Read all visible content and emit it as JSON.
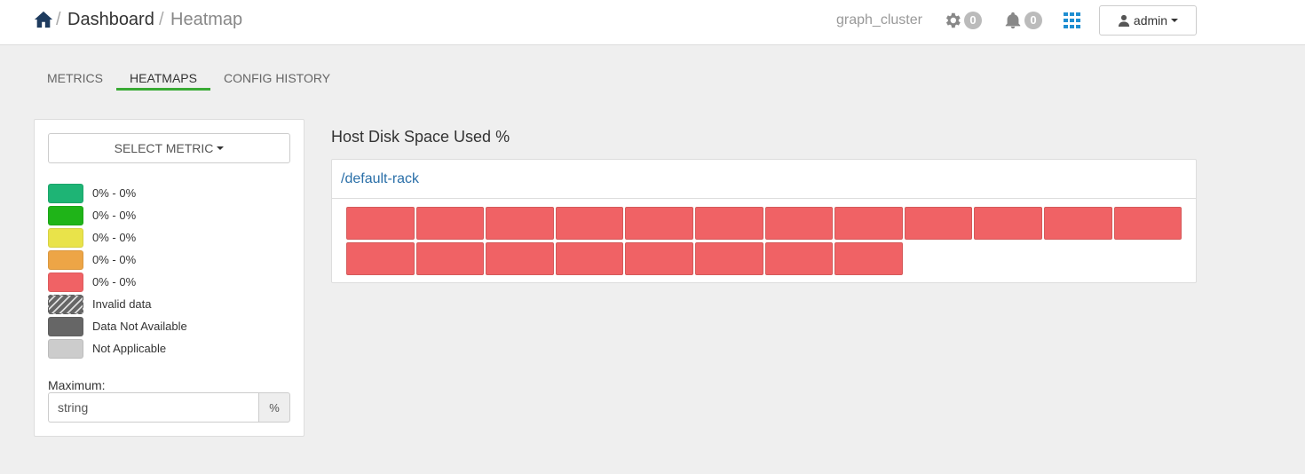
{
  "breadcrumb": {
    "sep1": "/",
    "dashboard": "Dashboard",
    "sep2": "/",
    "current": "Heatmap"
  },
  "header": {
    "cluster_name": "graph_cluster",
    "ops_count": "0",
    "alerts_count": "0",
    "user_label": "admin"
  },
  "tabs": [
    {
      "label": "METRICS",
      "active": false
    },
    {
      "label": "HEATMAPS",
      "active": true
    },
    {
      "label": "CONFIG HISTORY",
      "active": false
    }
  ],
  "sidebar": {
    "select_metric_label": "SELECT METRIC",
    "legend": [
      {
        "label": "0% - 0%",
        "color": "#1eb475"
      },
      {
        "label": "0% - 0%",
        "color": "#1fb418"
      },
      {
        "label": "0% - 0%",
        "color": "#e9e34a"
      },
      {
        "label": "0% - 0%",
        "color": "#eda546"
      },
      {
        "label": "0% - 0%",
        "color": "#f06265"
      },
      {
        "label": "Invalid data",
        "color": "hatch"
      },
      {
        "label": "Data Not Available",
        "color": "#666666"
      },
      {
        "label": "Not Applicable",
        "color": "#cccccc"
      }
    ],
    "maximum_label": "Maximum:",
    "maximum_value": "string",
    "maximum_unit": "%"
  },
  "heatmap": {
    "title": "Host Disk Space Used %",
    "rack_name": "/default-rack",
    "host_color": "#f06265",
    "host_count": 20
  },
  "colors": {
    "accent_tab": "#3aaa35",
    "link": "#2a6fa8",
    "grid_icon": "#1f8ed1"
  }
}
